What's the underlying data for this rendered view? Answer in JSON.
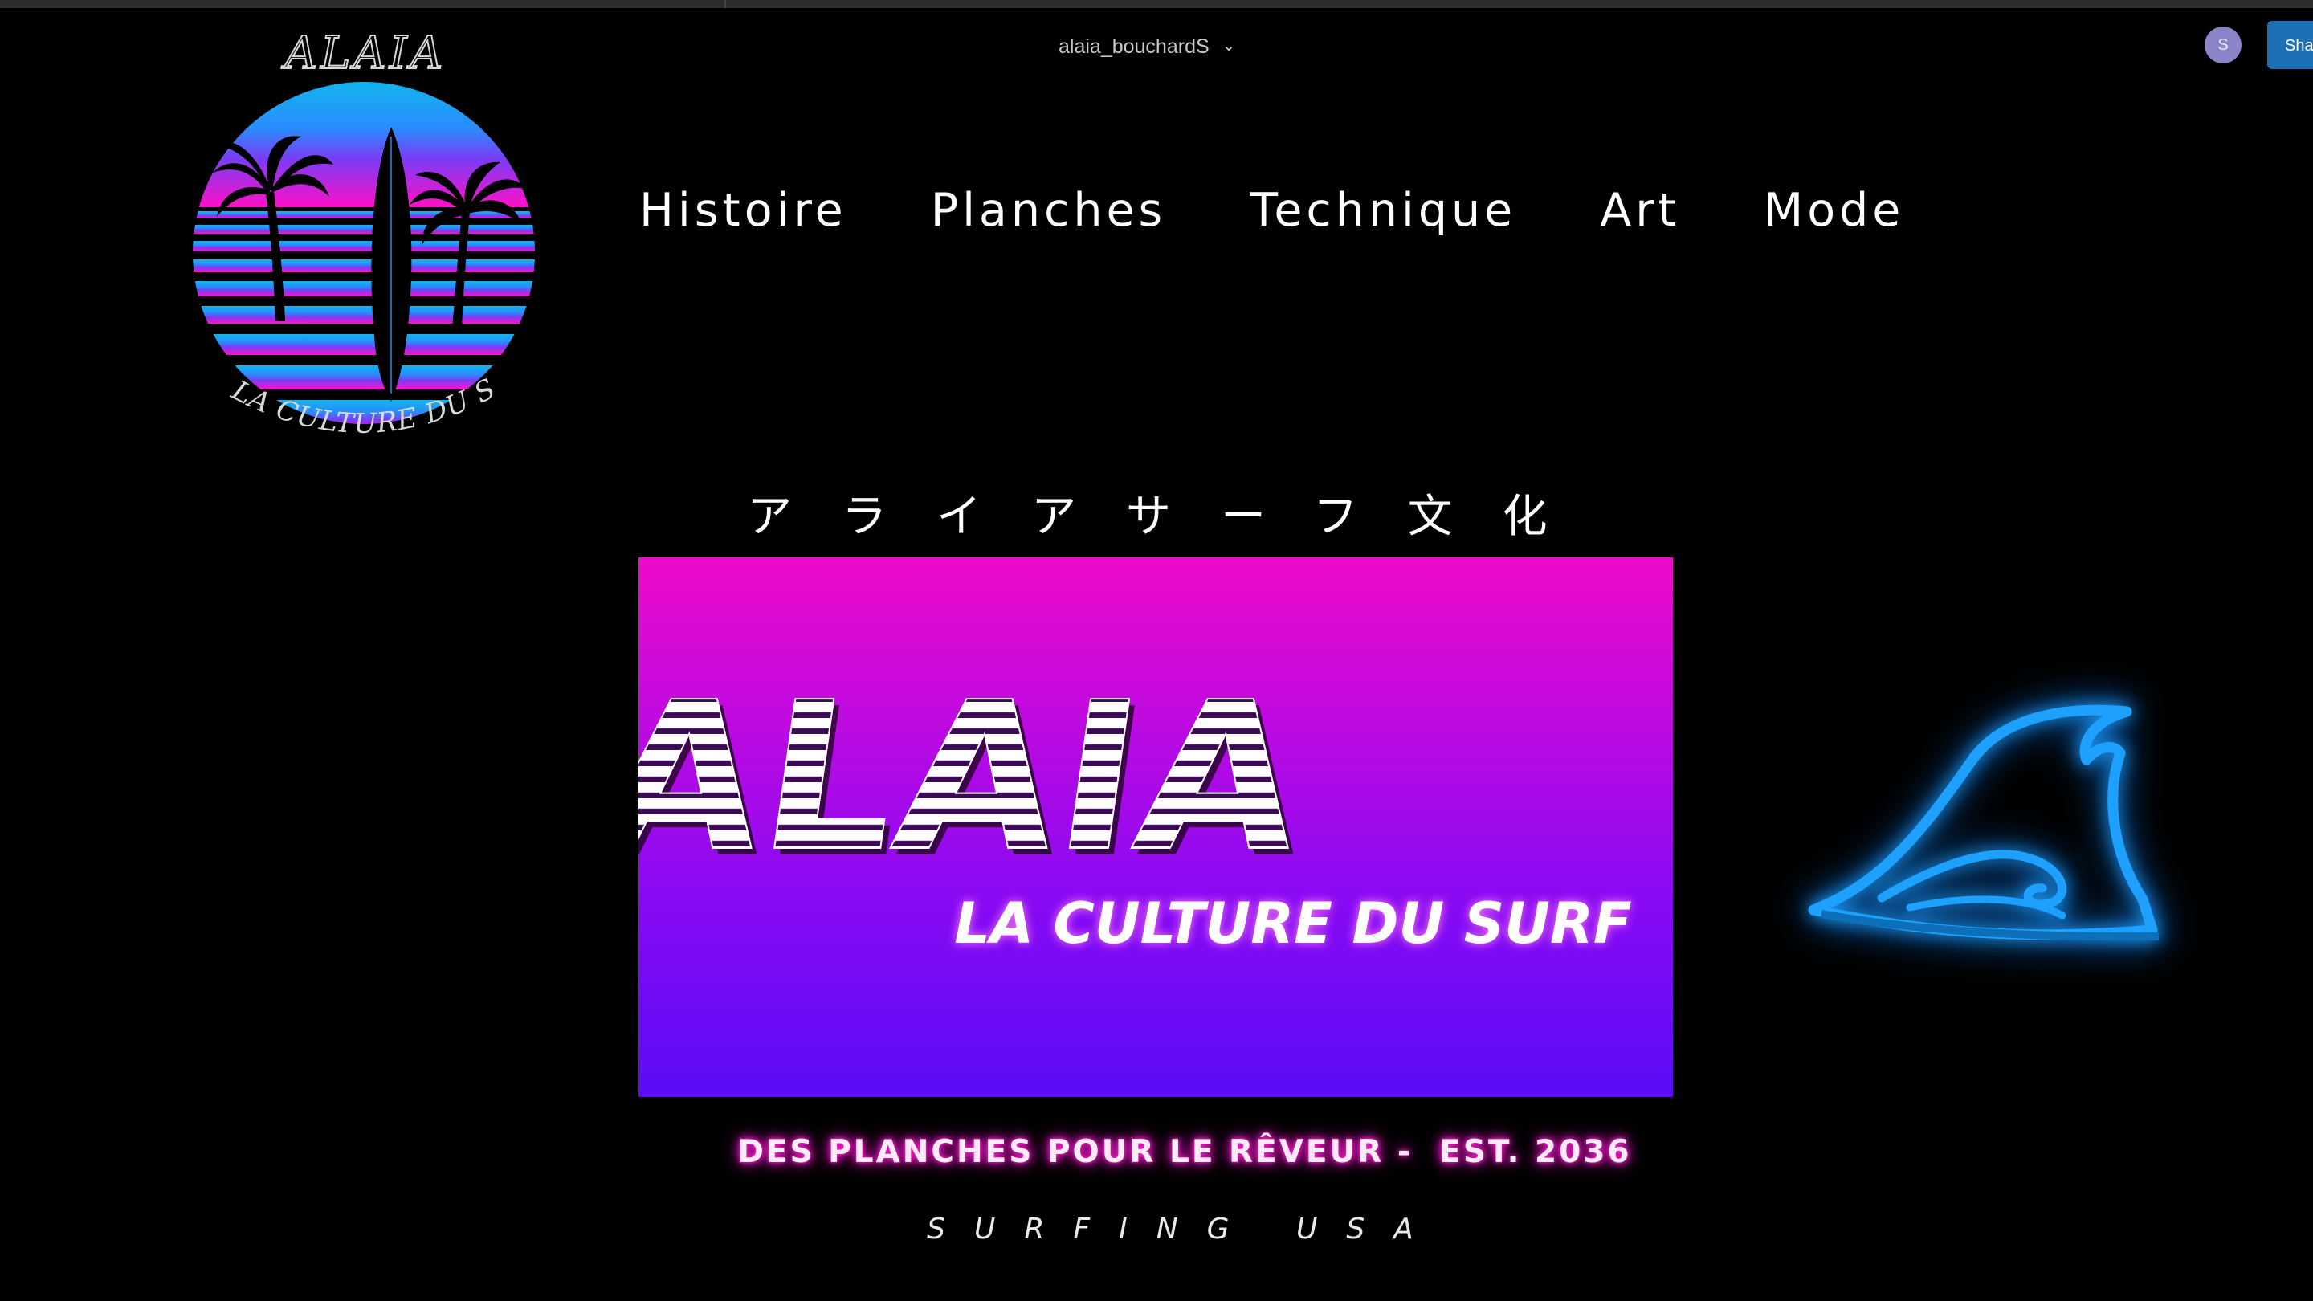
{
  "account": {
    "username": "alaia_bouchardS",
    "avatar_initial": "S",
    "share_label": "Sha"
  },
  "logo": {
    "brand_text": "ALAIA",
    "ring_text": "LA CULTURE DU SURF"
  },
  "nav": {
    "items": [
      "Histoire",
      "Planches",
      "Technique",
      "Art",
      "Mode"
    ]
  },
  "jp_heading": "アライアサーフ文化",
  "hero": {
    "title": "ALAIA",
    "subtitle": "LA CULTURE DU SURF"
  },
  "tagline": "DES PLANCHES POUR LE RÊVEUR -  EST. 2036",
  "subline": "SURFING USA",
  "colors": {
    "background": "#000000",
    "hero_top": "#ee0ac8",
    "hero_bottom": "#5a0cf7",
    "neon_pink": "#ff1fd0",
    "neon_blue": "#1ea0ff",
    "share_button": "#1f6fb5"
  },
  "icons": [
    "chevron-down-icon",
    "wave-icon",
    "palm-tree-icon",
    "surfboard-icon"
  ]
}
